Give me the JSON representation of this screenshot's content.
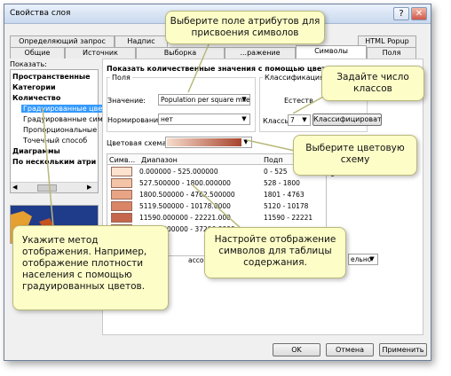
{
  "window": {
    "title": "Свойства слоя",
    "help_glyph": "?",
    "close_glyph": "✕"
  },
  "tabs_row1": [
    "Определяющий запрос",
    "Надпис",
    "",
    "",
    "HTML Popup"
  ],
  "tabs_row2": [
    "Общие",
    "Источник",
    "Выборка",
    "...ражение",
    "Символы",
    "Поля"
  ],
  "show_label": "Показать:",
  "tree": [
    "Пространственные",
    "Категории",
    "Количество",
    "Градуированные цве",
    "Градуированные сим",
    "Пропорциональные",
    "Точечный способ",
    "Диаграммы",
    "По нескольким атри"
  ],
  "main_heading": "Показать количественные значения с помощью цвета.",
  "fields": {
    "group_label": "Поля",
    "value_label": "Значение:",
    "value": "Population per square mile",
    "normalization_label": "Нормирование:",
    "normalization": "нет"
  },
  "classification": {
    "group_label": "Классификация",
    "method_partial": "Естеств",
    "classes_label": "Классы:",
    "classes_value": "7",
    "classify_button": "Классифицировать"
  },
  "color_scheme_label": "Цветовая схема:",
  "table": {
    "headers": [
      "Симв...",
      "Диапазон",
      "Подп"
    ],
    "rows": [
      {
        "color": "#fde3cf",
        "range": "0.000000 - 525.000000",
        "label": "0 - 525"
      },
      {
        "color": "#f3c4a6",
        "range": "527.500000 - 1800.000000",
        "label": "528 - 1800"
      },
      {
        "color": "#e8a484",
        "range": "1800.500000 - 4762.500000",
        "label": "1801 - 4763"
      },
      {
        "color": "#d98566",
        "range": "5119.500000 - 10178.0000",
        "label": "5120 - 10178"
      },
      {
        "color": "#c4674c",
        "range": "11590.000000 - 22221.000",
        "label": "11590 - 22221"
      },
      {
        "color": "#a84a35",
        "range": "31988.000000 - 37206.0000",
        "label": ""
      }
    ],
    "extra_label": "6",
    "partial_bottom_text": "ассов, и",
    "partial_dropdown": "ельно"
  },
  "buttons": {
    "ok": "OK",
    "cancel": "Отмена",
    "apply": "Применить"
  },
  "callouts": {
    "field": "Выберите поле атрибутов для присвоения символов",
    "classes": "Задайте число классов",
    "scheme": "Выберите цветовую схему",
    "method": "Укажите метод отображения. Например, отображение плотности населения с помощью градуированных цветов.",
    "table": "Настройте отображение символов для таблицы содержания."
  },
  "colors": {
    "callout_bg": "#fdfdc8",
    "ramp_start": "#f6dccc",
    "ramp_end": "#a8442c"
  }
}
